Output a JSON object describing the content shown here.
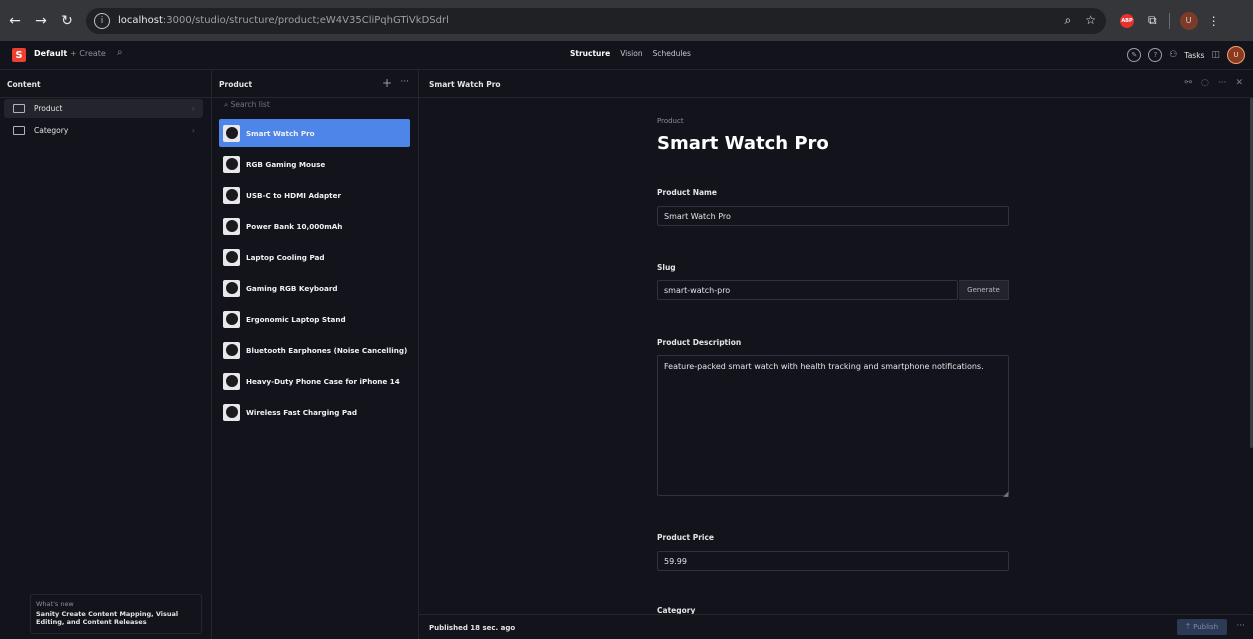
{
  "browser": {
    "url_host": "localhost",
    "url_path": ":3000/studio/structure/product;eW4V35CliPqhGTiVkDSdrl",
    "ext_abp": "ABP",
    "avatar": "U"
  },
  "studio": {
    "logo": "S",
    "workspace": "Default",
    "create_label": "+ Create",
    "tabs": [
      "Structure",
      "Vision",
      "Schedules"
    ],
    "tasks_label": "Tasks",
    "user_initial": "U"
  },
  "content_pane": {
    "title": "Content",
    "items": [
      {
        "label": "Product",
        "active": true
      },
      {
        "label": "Category",
        "active": false
      }
    ],
    "whats_new_label": "What's new",
    "whats_new_text": "Sanity Create Content Mapping, Visual Editing, and Content Releases"
  },
  "list_pane": {
    "title": "Product",
    "search_placeholder": "Search list",
    "items": [
      "Smart Watch Pro",
      "RGB Gaming Mouse",
      "USB-C to HDMI Adapter",
      "Power Bank 10,000mAh",
      "Laptop Cooling Pad",
      "Gaming RGB Keyboard",
      "Ergonomic Laptop Stand",
      "Bluetooth Earphones (Noise Cancelling)",
      "Heavy-Duty Phone Case for iPhone 14",
      "Wireless Fast Charging Pad"
    ]
  },
  "document": {
    "header_title": "Smart Watch Pro",
    "type_label": "Product",
    "heading": "Smart Watch Pro",
    "fields": {
      "name_label": "Product Name",
      "name_value": "Smart Watch Pro",
      "slug_label": "Slug",
      "slug_value": "smart-watch-pro",
      "generate_label": "Generate",
      "description_label": "Product Description",
      "description_value": "Feature-packed smart watch with health tracking and smartphone notifications.",
      "price_label": "Product Price",
      "price_value": "59.99",
      "category_label": "Category"
    },
    "status": "Published 18 sec. ago",
    "publish_label": "Publish"
  }
}
